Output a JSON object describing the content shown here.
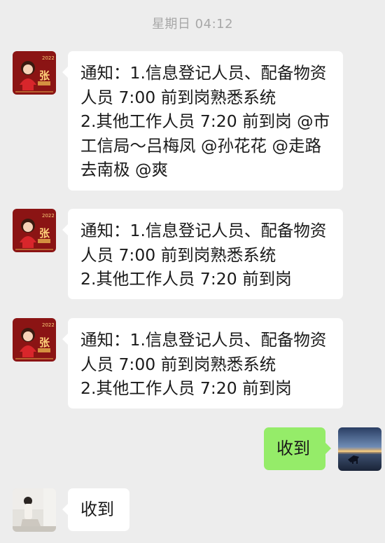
{
  "chat": {
    "timestamp": "星期日 04:12",
    "messages": [
      {
        "sender": "zhang-avatar",
        "side": "left",
        "text": "通知：1.信息登记人员、配备物资人员 7:00 前到岗熟悉系统\n2.其他工作人员 7:20 前到岗 @市工信局～吕梅凤 @孙花花 @走路去南极 @爽"
      },
      {
        "sender": "zhang-avatar",
        "side": "left",
        "text": "通知：1.信息登记人员、配备物资人员 7:00 前到岗熟悉系统\n2.其他工作人员 7:20 前到岗"
      },
      {
        "sender": "zhang-avatar",
        "side": "left",
        "text": "通知：1.信息登记人员、配备物资人员 7:00 前到岗熟悉系统\n2.其他工作人员 7:20 前到岗"
      },
      {
        "sender": "self-avatar",
        "side": "right",
        "text": "收到"
      },
      {
        "sender": "girl-avatar",
        "side": "left",
        "text": "收到"
      }
    ]
  },
  "avatars": {
    "zhang": {
      "year_text": "2022",
      "name_char": "张",
      "bg_color": "#8b1414"
    }
  },
  "colors": {
    "background": "#ededed",
    "bubble_left": "#ffffff",
    "bubble_right": "#95ec69",
    "timestamp": "#a8a8a8"
  }
}
